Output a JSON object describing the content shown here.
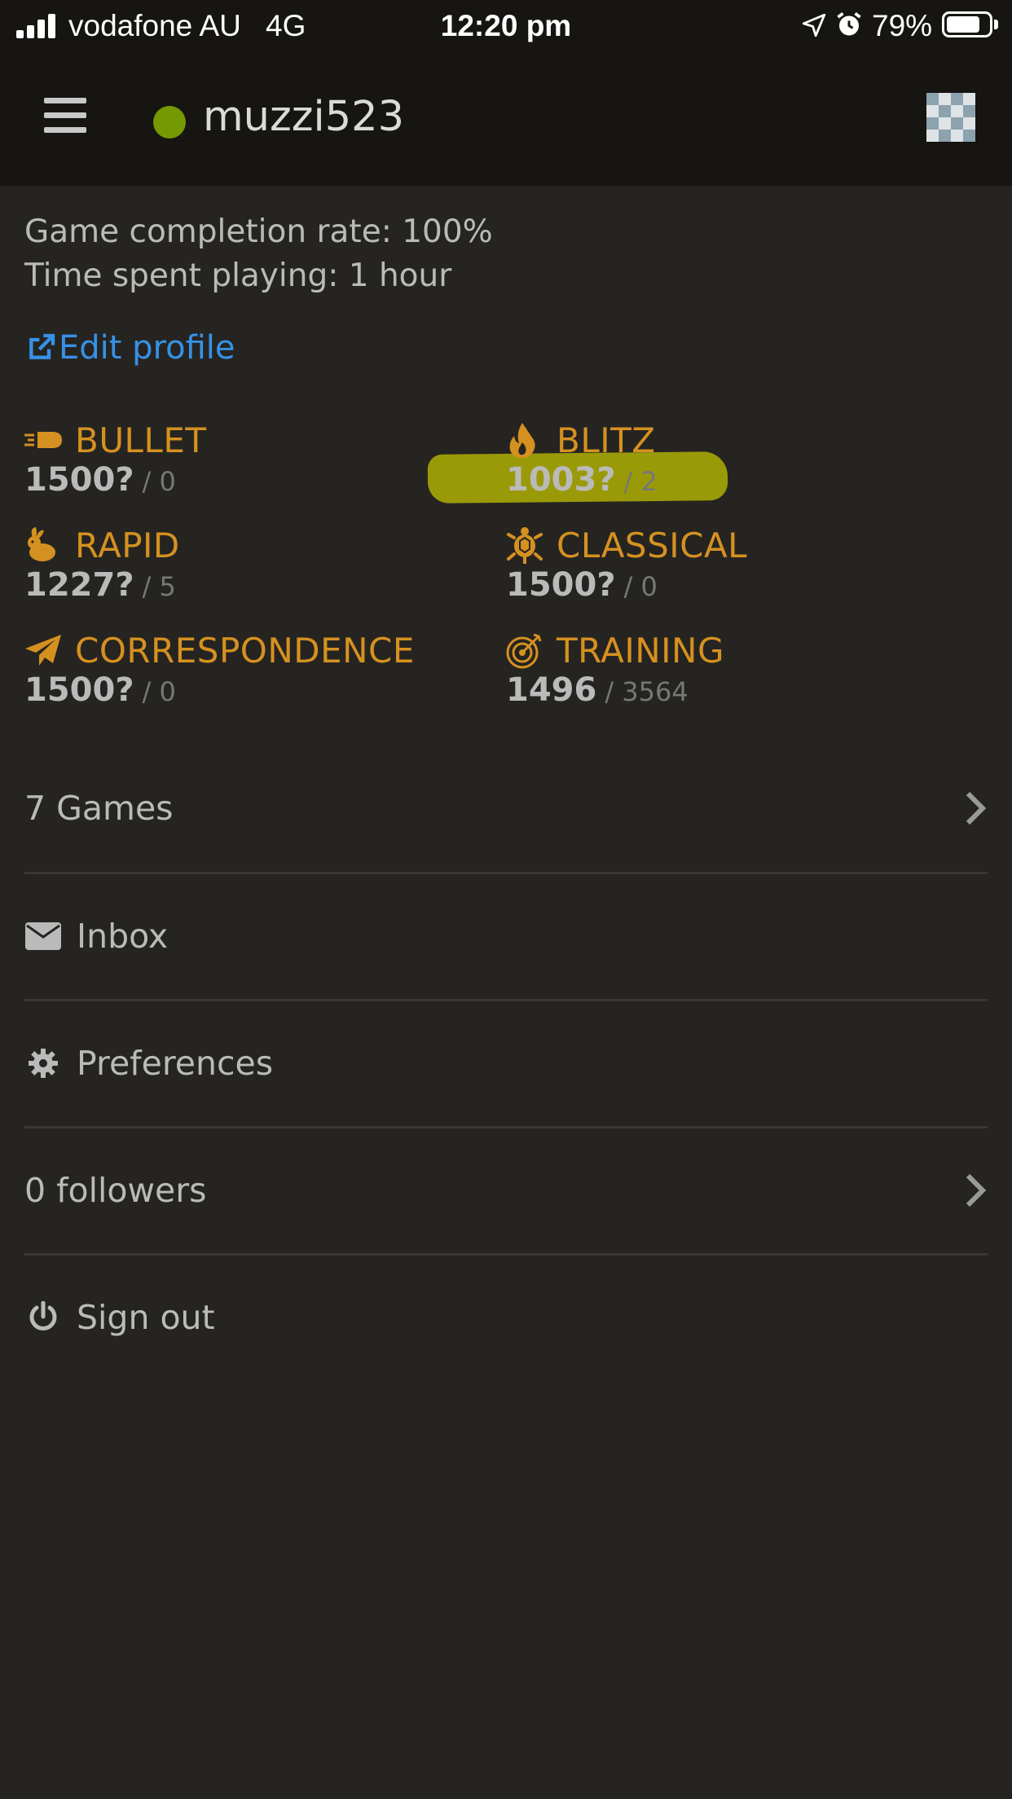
{
  "status_bar": {
    "carrier": "vodafone AU",
    "network": "4G",
    "time": "12:20 pm",
    "battery_percent": "79%",
    "battery_level": 0.79
  },
  "header": {
    "username": "muzzi523",
    "online_color": "#759900"
  },
  "profile": {
    "completion_rate": "Game completion rate: 100%",
    "time_playing": "Time spent playing: 1 hour",
    "edit_profile": "Edit profile"
  },
  "perfs": [
    {
      "name": "BULLET",
      "rating": "1500?",
      "games": "/ 0",
      "icon": "bullet-icon"
    },
    {
      "name": "BLITZ",
      "rating": "1003?",
      "games": "/ 2",
      "icon": "fire-icon"
    },
    {
      "name": "RAPID",
      "rating": "1227?",
      "games": "/ 5",
      "icon": "rabbit-icon"
    },
    {
      "name": "CLASSICAL",
      "rating": "1500?",
      "games": "/ 0",
      "icon": "turtle-icon"
    },
    {
      "name": "CORRESPONDENCE",
      "rating": "1500?",
      "games": "/ 0",
      "icon": "paper-plane-icon"
    },
    {
      "name": "TRAINING",
      "rating": "1496",
      "games": "/ 3564",
      "icon": "target-icon"
    }
  ],
  "menu": {
    "games": "7 Games",
    "inbox": "Inbox",
    "preferences": "Preferences",
    "followers": "0 followers",
    "sign_out": "Sign out"
  },
  "colors": {
    "background": "#262421",
    "header": "#161512",
    "accent": "#d59120",
    "link": "#3692e7"
  }
}
